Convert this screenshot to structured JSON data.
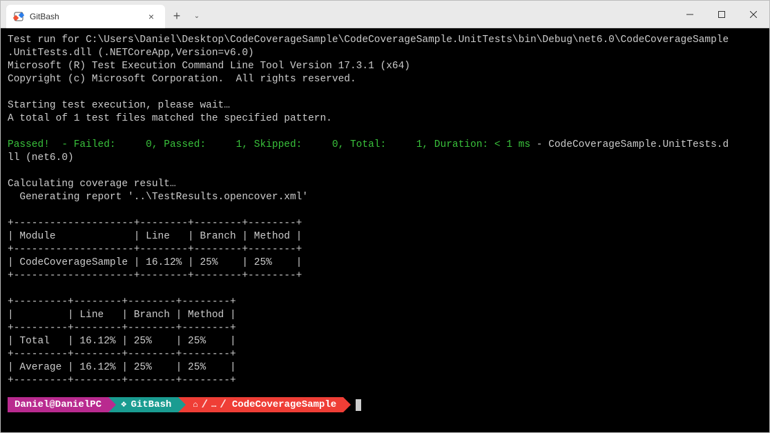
{
  "window": {
    "tab_title": "GitBash",
    "close_glyph": "×",
    "newtab_glyph": "+",
    "dropdown_glyph": "⌄"
  },
  "winbtns": {
    "min_glyph": "—",
    "max_glyph": "▢",
    "close_glyph": "✕"
  },
  "output": {
    "line1": "Test run for C:\\Users\\Daniel\\Desktop\\CodeCoverageSample\\CodeCoverageSample.UnitTests\\bin\\Debug\\net6.0\\CodeCoverageSample",
    "line2": ".UnitTests.dll (.NETCoreApp,Version=v6.0)",
    "line3": "Microsoft (R) Test Execution Command Line Tool Version 17.3.1 (x64)",
    "line4": "Copyright (c) Microsoft Corporation.  All rights reserved.",
    "line5": "",
    "line6": "Starting test execution, please wait…",
    "line7": "A total of 1 test files matched the specified pattern.",
    "line8": "",
    "passed_green": "Passed!  - Failed:     0, Passed:     1, Skipped:     0, Total:     1, Duration: < 1 ms",
    "passed_tail": " - CodeCoverageSample.UnitTests.d",
    "line10": "ll (net6.0)",
    "line11": "",
    "line12": "Calculating coverage result…",
    "line13": "  Generating report '..\\TestResults.opencover.xml'",
    "line14": "",
    "t1_border": "+--------------------+--------+--------+--------+",
    "t1_header": "| Module             | Line   | Branch | Method |",
    "t1_row": "| CodeCoverageSample | 16.12% | 25%    | 25%    |",
    "line_blank": "",
    "t2_border": "+---------+--------+--------+--------+",
    "t2_header": "|         | Line   | Branch | Method |",
    "t2_row1": "| Total   | 16.12% | 25%    | 25%    |",
    "t2_row2": "| Average | 16.12% | 25%    | 25%    |"
  },
  "prompt": {
    "user_host": "Daniel@DanielPC",
    "shell_icon": "❖",
    "shell": "GitBash",
    "home_icon": "⌂",
    "slash1": "/",
    "dots": "…",
    "slash2": "/",
    "folder": "CodeCoverageSample"
  },
  "chart_data": [
    {
      "type": "table",
      "title": "Module coverage",
      "columns": [
        "Module",
        "Line",
        "Branch",
        "Method"
      ],
      "rows": [
        [
          "CodeCoverageSample",
          "16.12%",
          "25%",
          "25%"
        ]
      ]
    },
    {
      "type": "table",
      "title": "Summary coverage",
      "columns": [
        "",
        "Line",
        "Branch",
        "Method"
      ],
      "rows": [
        [
          "Total",
          "16.12%",
          "25%",
          "25%"
        ],
        [
          "Average",
          "16.12%",
          "25%",
          "25%"
        ]
      ]
    }
  ]
}
